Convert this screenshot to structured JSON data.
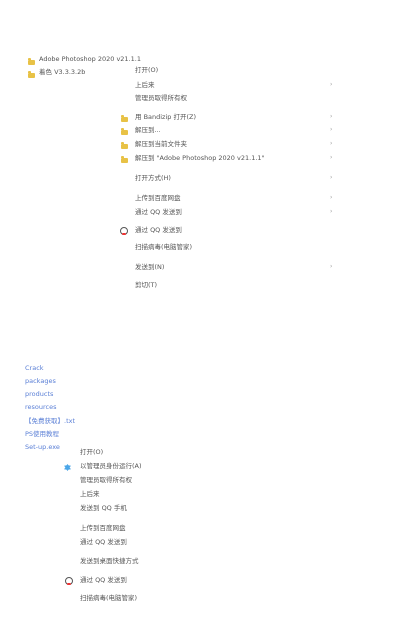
{
  "explorer_top": {
    "items": [
      {
        "label": "Adobe Photoshop 2020 v21.1.1"
      },
      {
        "label": "着色 V3.3.3.2b"
      }
    ]
  },
  "context_menu_1": {
    "items": [
      {
        "label": "打开(O)",
        "submenu": false
      },
      {
        "label": "上后来",
        "submenu": true
      },
      {
        "label": "管理员取得所有权",
        "submenu": false
      },
      {
        "label": "用 Bandizip 打开(Z)",
        "submenu": true
      },
      {
        "label": "解压到...",
        "submenu": true
      },
      {
        "label": "解压到当前文件夹",
        "submenu": true
      },
      {
        "label": "解压到 \"Adobe Photoshop 2020 v21.1.1\"",
        "submenu": true
      },
      {
        "label": "打开方式(H)",
        "submenu": true
      },
      {
        "label": "上传到百度网盘",
        "submenu": true
      },
      {
        "label": "通过 QQ 发送到",
        "submenu": true
      },
      {
        "label": "通过 QQ 发送到",
        "submenu": false
      },
      {
        "label": "扫描病毒(电脑管家)",
        "submenu": false
      },
      {
        "label": "发送到(N)",
        "submenu": true
      },
      {
        "label": "剪切(T)",
        "submenu": false
      }
    ]
  },
  "explorer_bottom": {
    "items": [
      {
        "label": "Crack"
      },
      {
        "label": "packages"
      },
      {
        "label": "products"
      },
      {
        "label": "resources"
      },
      {
        "label": "【免费获取】.txt"
      },
      {
        "label": "PS使用教程"
      },
      {
        "label": "Set-up.exe"
      }
    ]
  },
  "context_menu_2": {
    "items": [
      {
        "label": "打开(O)"
      },
      {
        "label": "以管理员身份运行(A)"
      },
      {
        "label": "管理员取得所有权"
      },
      {
        "label": "上后来"
      },
      {
        "label": "发送到 QQ 手机"
      },
      {
        "label": "上传到百度网盘"
      },
      {
        "label": "通过 QQ 发送到"
      },
      {
        "label": "发送到桌面快捷方式"
      },
      {
        "label": "通过 QQ 发送到"
      },
      {
        "label": "扫描病毒(电脑管家)"
      }
    ]
  }
}
